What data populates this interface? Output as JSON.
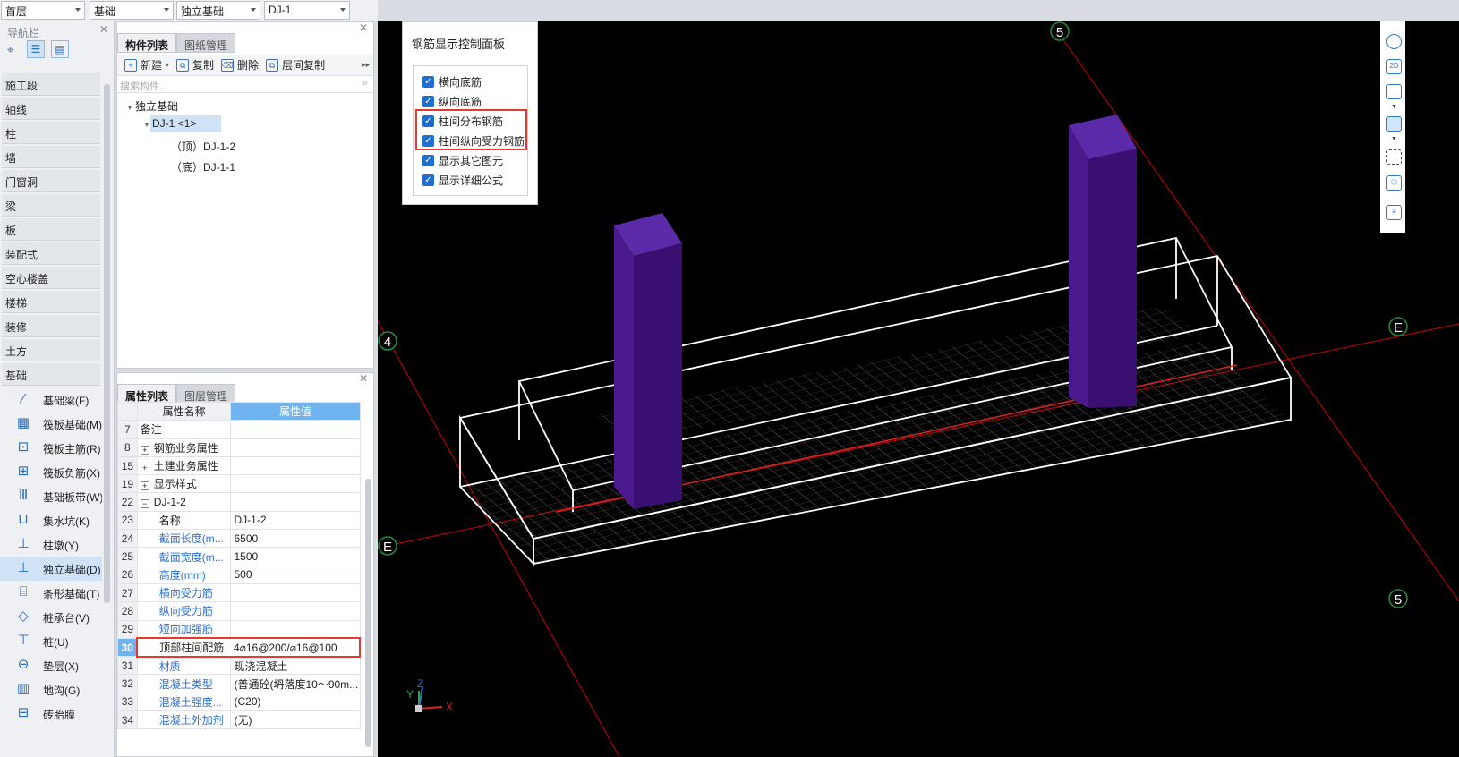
{
  "topbar": {
    "floor": "首层",
    "category": "基础",
    "type": "独立基础",
    "component": "DJ-1"
  },
  "nav": {
    "title": "导航栏",
    "categories": [
      "施工段",
      "轴线",
      "柱",
      "墙",
      "门窗洞",
      "梁",
      "板",
      "装配式",
      "空心楼盖",
      "楼梯",
      "装修",
      "土方",
      "基础"
    ],
    "sub_items": [
      {
        "label": "基础梁(F)",
        "icon": "foundation-beam-icon",
        "glyph": "⁄"
      },
      {
        "label": "筏板基础(M)",
        "icon": "raft-foundation-icon",
        "glyph": "▦"
      },
      {
        "label": "筏板主筋(R)",
        "icon": "raft-main-rebar-icon",
        "glyph": "⊡"
      },
      {
        "label": "筏板负筋(X)",
        "icon": "raft-negative-rebar-icon",
        "glyph": "⊞"
      },
      {
        "label": "基础板带(W)",
        "icon": "foundation-strip-icon",
        "glyph": "Ⅲ"
      },
      {
        "label": "集水坑(K)",
        "icon": "sump-pit-icon",
        "glyph": "⊔"
      },
      {
        "label": "柱墩(Y)",
        "icon": "column-pier-icon",
        "glyph": "⊥"
      },
      {
        "label": "独立基础(D)",
        "icon": "isolated-foundation-icon",
        "glyph": "⊥"
      },
      {
        "label": "条形基础(T)",
        "icon": "strip-foundation-icon",
        "glyph": "⌸"
      },
      {
        "label": "桩承台(V)",
        "icon": "pile-cap-icon",
        "glyph": "◇"
      },
      {
        "label": "桩(U)",
        "icon": "pile-icon",
        "glyph": "⊤"
      },
      {
        "label": "垫层(X)",
        "icon": "cushion-icon",
        "glyph": "⊖"
      },
      {
        "label": "地沟(G)",
        "icon": "trench-icon",
        "glyph": "▥"
      },
      {
        "label": "砖胎膜",
        "icon": "brick-form-icon",
        "glyph": "⊟"
      }
    ]
  },
  "component_panel": {
    "tabs": [
      "构件列表",
      "图纸管理"
    ],
    "toolbar": {
      "new": "新建",
      "copy": "复制",
      "delete": "删除",
      "floor_copy": "层间复制"
    },
    "search_placeholder": "搜索构件...",
    "tree": {
      "root": "独立基础",
      "item": "DJ-1 <1>",
      "child_top": "（顶）DJ-1-2",
      "child_bottom": "（底）DJ-1-1"
    }
  },
  "property_panel": {
    "tabs": [
      "属性列表",
      "图层管理"
    ],
    "headers": [
      "属性名称",
      "属性值"
    ],
    "rows": [
      {
        "n": "7",
        "key": "备注",
        "val": "",
        "style": "plain"
      },
      {
        "n": "8",
        "key": "钢筋业务属性",
        "val": "",
        "style": "group"
      },
      {
        "n": "15",
        "key": "土建业务属性",
        "val": "",
        "style": "group"
      },
      {
        "n": "19",
        "key": "显示样式",
        "val": "",
        "style": "group"
      },
      {
        "n": "22",
        "key": "DJ-1-2",
        "val": "",
        "style": "section"
      },
      {
        "n": "23",
        "key": "名称",
        "val": "DJ-1-2",
        "style": "child"
      },
      {
        "n": "24",
        "key": "截面长度(m...",
        "val": "6500",
        "style": "child"
      },
      {
        "n": "25",
        "key": "截面宽度(m...",
        "val": "1500",
        "style": "child"
      },
      {
        "n": "26",
        "key": "高度(mm)",
        "val": "500",
        "style": "child"
      },
      {
        "n": "27",
        "key": "横向受力筋",
        "val": "",
        "style": "child"
      },
      {
        "n": "28",
        "key": "纵向受力筋",
        "val": "",
        "style": "child"
      },
      {
        "n": "29",
        "key": "短向加强筋",
        "val": "",
        "style": "child"
      },
      {
        "n": "30",
        "key": "顶部柱间配筋",
        "val": "4⌀16@200/⌀16@100",
        "style": "highlight"
      },
      {
        "n": "31",
        "key": "材质",
        "val": "现浇混凝土",
        "style": "child"
      },
      {
        "n": "32",
        "key": "混凝土类型",
        "val": "(普通砼(坍落度10～90m...",
        "style": "child"
      },
      {
        "n": "33",
        "key": "混凝土强度...",
        "val": "(C20)",
        "style": "child"
      },
      {
        "n": "34",
        "key": "混凝土外加剂",
        "val": "(无)",
        "style": "child"
      }
    ]
  },
  "control_panel": {
    "title": "钢筋显示控制面板",
    "options": [
      "横向底筋",
      "纵向底筋",
      "柱间分布钢筋",
      "柱间纵向受力钢筋",
      "显示其它图元",
      "显示详细公式"
    ]
  },
  "viewport": {
    "axis_labels": [
      "5",
      "4",
      "E",
      "E",
      "5"
    ],
    "axis_letters": [
      "Y",
      "Z",
      "X"
    ]
  },
  "colors": {
    "accent": "#2c6fd6",
    "highlight": "#e53935",
    "column": "#4a1a8c",
    "grid_axis": "#cc0000"
  }
}
